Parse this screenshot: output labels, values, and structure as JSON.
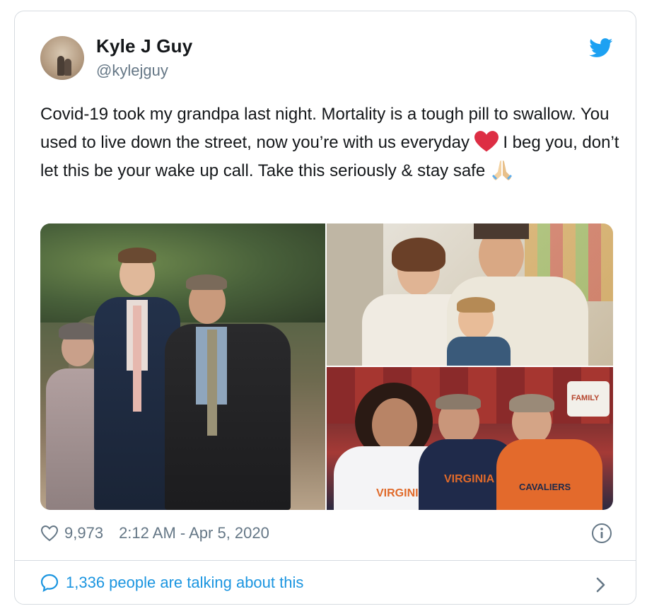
{
  "tweet": {
    "author_name": "Kyle J Guy",
    "author_handle": "@kylejguy",
    "text_parts": [
      "Covid-19 took my grandpa last night. Mortality is a tough pill to swallow. You used to live down the street, now you’re with us everyday ",
      " I beg you, don’t let this be your wake up call. Take this seriously & stay safe "
    ],
    "emoji_1": "red-heart",
    "emoji_2": "folded-hands",
    "likes": "9,973",
    "timestamp": "2:12 AM - Apr 5, 2020",
    "talking": "1,336 people are talking about this"
  },
  "media": {
    "photo_1_text": "",
    "photo_3_shirt_text_1": "VIRGINIA",
    "photo_3_shirt_text_2": "VIRGINIA",
    "photo_3_shirt_text_3": "CAVALIERS",
    "photo_3_fan_sign": "FAMILY"
  },
  "colors": {
    "brand_blue": "#1da1f2",
    "link_blue": "#1b95e0",
    "secondary_text": "#657786",
    "heart_red": "#e0245e"
  },
  "icons": [
    "twitter-bird-icon",
    "like-heart-icon",
    "info-icon",
    "speech-bubble-icon",
    "chevron-right-icon"
  ]
}
